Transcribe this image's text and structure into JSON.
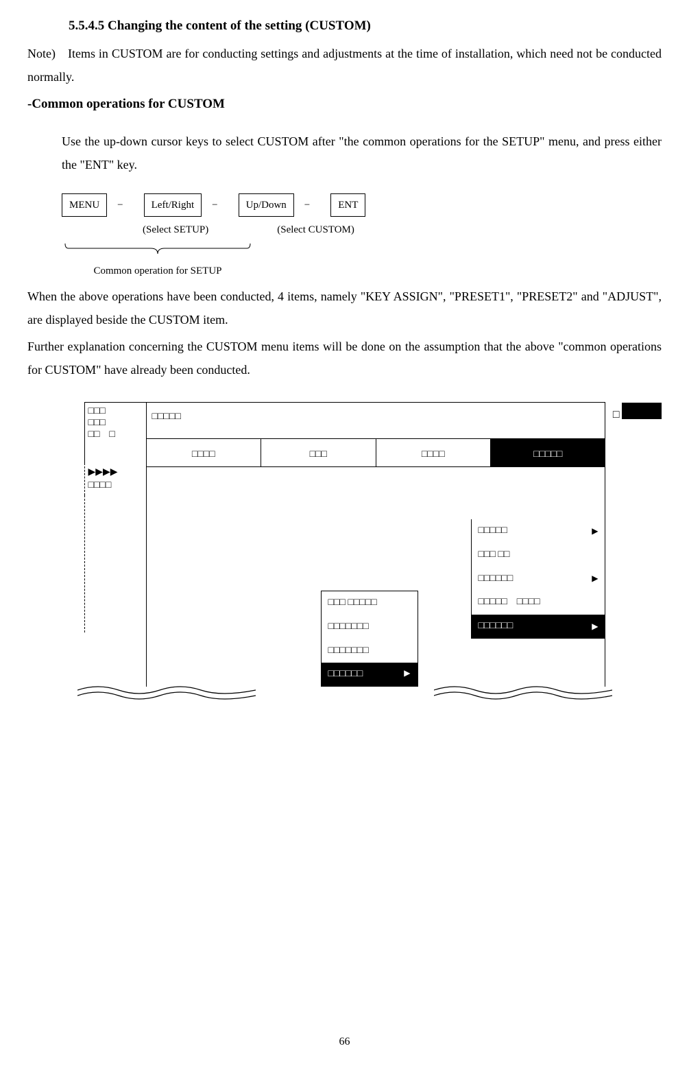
{
  "section_title": "5.5.4.5 Changing the content of the setting (CUSTOM)",
  "note_text": "Note) Items in CUSTOM are for conducting settings and adjustments at the time of installation, which need not be conducted normally.",
  "sub_heading": "-Common operations for CUSTOM",
  "instruction_text": "Use the up-down cursor keys to select CUSTOM after \"the common operations for the SETUP\" menu, and press either the \"ENT\" key.",
  "flow": {
    "menu": "MENU",
    "left_right": "Left/Right",
    "up_down": "Up/Down",
    "ent": "ENT",
    "sep": "−　",
    "select_setup": "(Select SETUP)",
    "select_custom": "(Select CUSTOM)",
    "brace_label": "Common operation for SETUP"
  },
  "body_para1": "When the above operations have been conducted, 4 items, namely \"KEY ASSIGN\", \"PRESET1\", \"PRESET2\" and \"ADJUST\", are displayed beside the CUSTOM item.",
  "body_para2": "Further explanation concerning the CUSTOM menu items will be done on the assumption that the above \"common operations for CUSTOM\" have already been conducted.",
  "diagram": {
    "sidebar_line1": "□□□",
    "sidebar_line2": "□□□",
    "sidebar_line3": "□□　□",
    "sidebar_arrows": "▶▶▶▶",
    "sidebar_below": "□□□□",
    "header": "□□□□□",
    "tabs": [
      "□□□□",
      "□□□",
      "□□□□",
      "□□□□□"
    ],
    "submenu": [
      {
        "label": "□□□□□",
        "arrow": "▶",
        "selected": false
      },
      {
        "label": "□□□ □□",
        "arrow": "",
        "selected": false
      },
      {
        "label": "□□□□□□",
        "arrow": "▶",
        "selected": false
      },
      {
        "label": "□□□□□　□□□□",
        "arrow": "",
        "selected": false
      },
      {
        "label": "□□□□□□",
        "arrow": "▶",
        "selected": true
      }
    ],
    "submenu2": [
      {
        "label": "□□□ □□□□□",
        "arrow": "",
        "selected": false
      },
      {
        "label": "□□□□□□□",
        "arrow": "",
        "selected": false
      },
      {
        "label": "□□□□□□□",
        "arrow": "",
        "selected": false
      },
      {
        "label": "□□□□□□",
        "arrow": "▶",
        "selected": true
      }
    ],
    "right_open": "□"
  },
  "page_number": "66"
}
